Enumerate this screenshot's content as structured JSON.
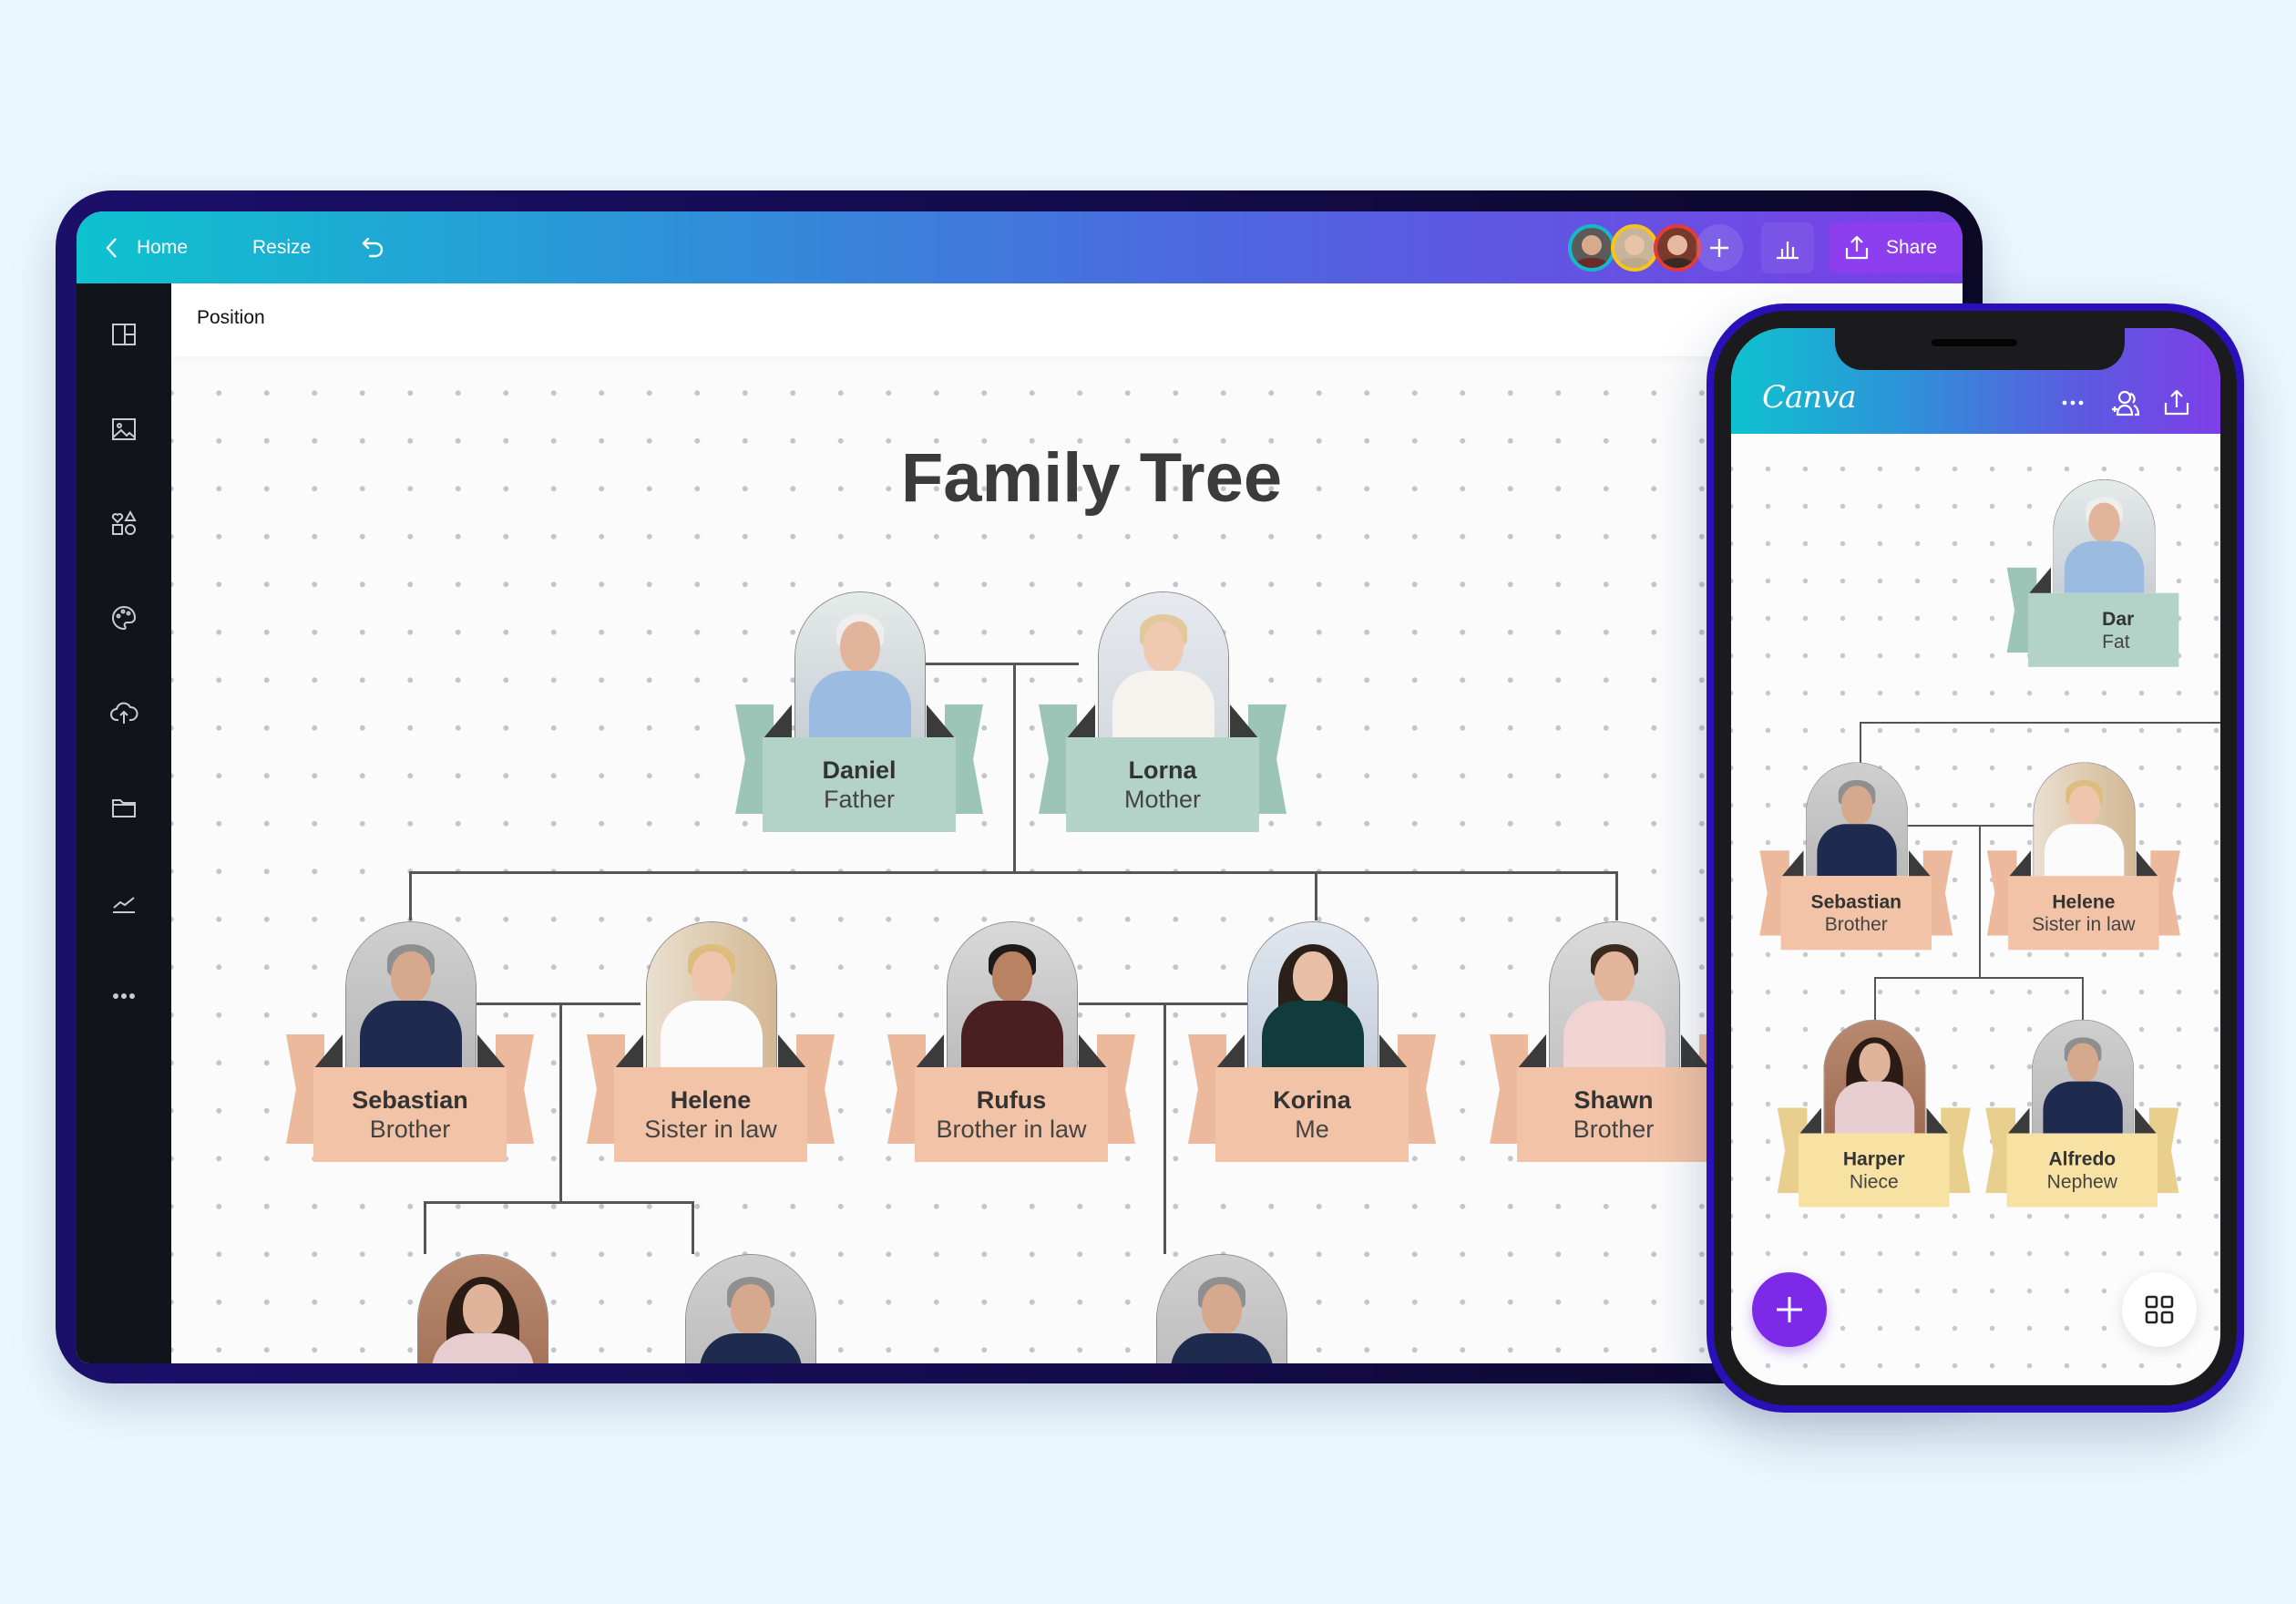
{
  "editor": {
    "topbar": {
      "back_label": "Home",
      "resize_label": "Resize",
      "undo_icon": "undo-icon",
      "collaborators": [
        {
          "name": "collaborator-1",
          "ring_color": "#17b7c9"
        },
        {
          "name": "collaborator-2",
          "ring_color": "#f5c518"
        },
        {
          "name": "collaborator-3",
          "ring_color": "#e23b3b"
        }
      ],
      "add_collaborator_icon": "plus-icon",
      "insights_icon": "bar-chart-icon",
      "share_label": "Share",
      "share_icon": "upload-icon"
    },
    "sidebar": {
      "items": [
        {
          "name": "templates",
          "icon": "layout-icon"
        },
        {
          "name": "photos",
          "icon": "image-icon"
        },
        {
          "name": "elements",
          "icon": "shapes-icon"
        },
        {
          "name": "styles",
          "icon": "palette-icon"
        },
        {
          "name": "uploads",
          "icon": "cloud-upload-icon"
        },
        {
          "name": "projects",
          "icon": "folder-icon"
        },
        {
          "name": "charts",
          "icon": "line-chart-icon"
        },
        {
          "name": "more",
          "icon": "more-horizontal-icon"
        }
      ]
    },
    "properties_bar": {
      "label": "Position"
    },
    "design": {
      "title": "Family Tree",
      "parents": [
        {
          "name": "Daniel",
          "relation": "Father",
          "color": "green"
        },
        {
          "name": "Lorna",
          "relation": "Mother",
          "color": "green"
        }
      ],
      "children": [
        {
          "name": "Sebastian",
          "relation": "Brother",
          "color": "peach"
        },
        {
          "name": "Helene",
          "relation": "Sister in law",
          "color": "peach"
        },
        {
          "name": "Rufus",
          "relation": "Brother in law",
          "color": "peach"
        },
        {
          "name": "Korina",
          "relation": "Me",
          "color": "peach"
        },
        {
          "name": "Shawn",
          "relation": "Brother",
          "color": "peach"
        }
      ],
      "grandchildren_partial": [
        {
          "name": "Harper",
          "relation": "Niece"
        },
        {
          "name": "Alfredo",
          "relation": "Nephew"
        },
        {
          "name": "Alfredo",
          "relation": "Nephew"
        }
      ]
    }
  },
  "mobile": {
    "brand": "Canva",
    "header_icons": [
      "more-horizontal-icon",
      "add-people-icon",
      "upload-icon"
    ],
    "visible_cards": [
      {
        "name": "Daniel",
        "relation": "Father",
        "color": "green",
        "partial": true,
        "name_visible": "Dar",
        "relation_visible": "Fat"
      },
      {
        "name": "Sebastian",
        "relation": "Brother",
        "color": "peach"
      },
      {
        "name": "Helene",
        "relation": "Sister in law",
        "color": "peach"
      },
      {
        "name": "Harper",
        "relation": "Niece",
        "color": "yellow"
      },
      {
        "name": "Alfredo",
        "relation": "Nephew",
        "color": "yellow"
      }
    ],
    "fab_add_icon": "plus-icon",
    "fab_pages_icon": "grid-icon",
    "accent": "#7d2ae8"
  }
}
